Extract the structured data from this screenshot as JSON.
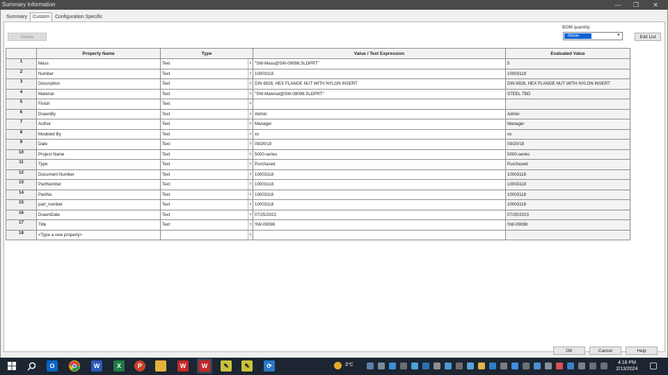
{
  "window": {
    "title": "Summary Information"
  },
  "tabs": [
    "Summary",
    "Custom",
    "Configuration Specific"
  ],
  "toolbar": {
    "delete_label": "Delete",
    "bom_label": "BOM quantity:",
    "bom_value": "-None-",
    "edit_list_label": "Edit List"
  },
  "table": {
    "columns": [
      "",
      "Property Name",
      "Type",
      "Value / Text Expression",
      "Evaluated Value"
    ],
    "rows": [
      {
        "num": "1",
        "name": "Mass",
        "type": "Text",
        "value": "\"SW-Mass@SW-09098.SLDPRT\"",
        "evaluated": "5"
      },
      {
        "num": "2",
        "name": "Number",
        "type": "Text",
        "value": "10003118",
        "evaluated": "10003118"
      },
      {
        "num": "3",
        "name": "Description",
        "type": "Text",
        "value": "DIN 6926, HEX FLANGE NUT WITH NYLON INSERT",
        "evaluated": "DIN 6926, HEX FLANGE NUT WITH NYLON INSERT"
      },
      {
        "num": "4",
        "name": "Material",
        "type": "Text",
        "value": "\"SW-Material@SW-09098.SLDPRT\"",
        "evaluated": "STEEL TBD"
      },
      {
        "num": "5",
        "name": "Finish",
        "type": "Text",
        "value": "",
        "evaluated": ""
      },
      {
        "num": "6",
        "name": "DrawnBy",
        "type": "Text",
        "value": "Admin",
        "evaluated": "Admin"
      },
      {
        "num": "7",
        "name": "Author",
        "type": "Text",
        "value": "Manager",
        "evaluated": "Manager"
      },
      {
        "num": "8",
        "name": "Modeled By",
        "type": "Text",
        "value": "xx",
        "evaluated": "xx"
      },
      {
        "num": "9",
        "name": "Date",
        "type": "Text",
        "value": "09/20/19",
        "evaluated": "09/20/19"
      },
      {
        "num": "10",
        "name": "Project Name",
        "type": "Text",
        "value": "5000-series",
        "evaluated": "5000-series"
      },
      {
        "num": "11",
        "name": "Type",
        "type": "Text",
        "value": "Purchased",
        "evaluated": "Purchased"
      },
      {
        "num": "12",
        "name": "Document Number",
        "type": "Text",
        "value": "10003118",
        "evaluated": "10003118"
      },
      {
        "num": "13",
        "name": "PartNumber",
        "type": "Text",
        "value": "10003118",
        "evaluated": "10003118"
      },
      {
        "num": "14",
        "name": "PartNo",
        "type": "Text",
        "value": "10003118",
        "evaluated": "10003118"
      },
      {
        "num": "15",
        "name": "part_number",
        "type": "Text",
        "value": "10003118",
        "evaluated": "10003118"
      },
      {
        "num": "16",
        "name": "DrawnDate",
        "type": "Text",
        "value": "07/25/2023",
        "evaluated": "07/25/2023"
      },
      {
        "num": "17",
        "name": "Title",
        "type": "Text",
        "value": "SW-09098",
        "evaluated": "SW-09098"
      },
      {
        "num": "18",
        "name": "<Type a new property>",
        "type": "",
        "value": "",
        "evaluated": ""
      }
    ]
  },
  "footer": {
    "ok_label": "OK",
    "cancel_label": "Cancel",
    "help_label": "Help"
  },
  "taskbar": {
    "weather": "3°C",
    "time": "4:18 PM",
    "date": "2/13/2024",
    "icons": [
      "start-icon",
      "search-icon",
      "outlook-icon",
      "chrome-icon",
      "word-icon",
      "excel-icon",
      "powerpoint-icon",
      "file-explorer-icon",
      "solidworks-icon",
      "solidworks-active-icon",
      "app-icon",
      "app-icon-2",
      "network-icon"
    ]
  }
}
